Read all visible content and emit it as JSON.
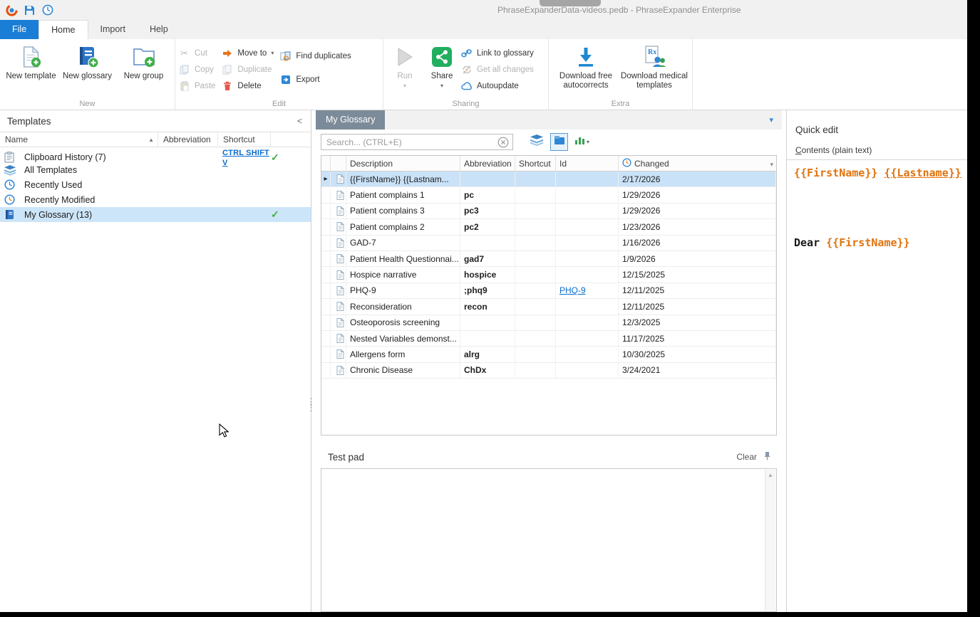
{
  "titlebar": {
    "title": "PhraseExpanderData-videos.pedb - PhraseExpander Enterprise"
  },
  "ribbon_tabs": {
    "file": "File",
    "home": "Home",
    "import": "Import",
    "help": "Help"
  },
  "ribbon": {
    "groups": {
      "new": {
        "label": "New",
        "new_template": "New template",
        "new_glossary": "New glossary",
        "new_group": "New group"
      },
      "edit": {
        "label": "Edit",
        "cut": "Cut",
        "copy": "Copy",
        "paste": "Paste",
        "move_to": "Move to",
        "duplicate": "Duplicate",
        "delete": "Delete",
        "find_duplicates": "Find duplicates",
        "export": "Export"
      },
      "sharing": {
        "label": "Sharing",
        "run": "Run",
        "share": "Share",
        "link_to_glossary": "Link to glossary",
        "get_all_changes": "Get all changes",
        "autoupdate": "Autoupdate"
      },
      "extra": {
        "label": "Extra",
        "download_autocorrects_line1": "Download free",
        "download_autocorrects_line2": "autocorrects",
        "download_medical_line1": "Download medical",
        "download_medical_line2": "templates"
      }
    }
  },
  "templates_panel": {
    "title": "Templates",
    "columns": {
      "name": "Name",
      "abbreviation": "Abbreviation",
      "shortcut": "Shortcut"
    },
    "items": [
      {
        "name": "Clipboard History (7)",
        "shortcut": "CTRL SHIFT V",
        "checked": true,
        "selected": false,
        "icon": "clipboard-icon"
      },
      {
        "name": "All Templates",
        "shortcut": "",
        "checked": false,
        "selected": false,
        "icon": "layers-icon"
      },
      {
        "name": "Recently Used",
        "shortcut": "",
        "checked": false,
        "selected": false,
        "icon": "clock-icon"
      },
      {
        "name": "Recently Modified",
        "shortcut": "",
        "checked": false,
        "selected": false,
        "icon": "clock-modified-icon"
      },
      {
        "name": "My Glossary (13)",
        "shortcut": "",
        "checked": true,
        "selected": true,
        "icon": "glossary-book-icon"
      }
    ]
  },
  "glossary_panel": {
    "tab_title": "My Glossary",
    "search_placeholder": "Search... (CTRL+E)",
    "columns": {
      "description": "Description",
      "abbreviation": "Abbreviation",
      "shortcut": "Shortcut",
      "id": "Id",
      "changed": "Changed"
    },
    "rows": [
      {
        "description": "{{FirstName}} {{Lastnam...",
        "abbreviation": "",
        "shortcut": "",
        "id": "",
        "changed": "2/17/2026",
        "selected": true
      },
      {
        "description": "Patient complains 1",
        "abbreviation": "pc",
        "shortcut": "",
        "id": "",
        "changed": "1/29/2026"
      },
      {
        "description": "Patient complains 3",
        "abbreviation": "pc3",
        "shortcut": "",
        "id": "",
        "changed": "1/29/2026"
      },
      {
        "description": "Patient complains 2",
        "abbreviation": "pc2",
        "shortcut": "",
        "id": "",
        "changed": "1/23/2026"
      },
      {
        "description": "GAD-7",
        "abbreviation": "",
        "shortcut": "",
        "id": "",
        "changed": "1/16/2026"
      },
      {
        "description": "Patient Health Questionnai...",
        "abbreviation": "gad7",
        "shortcut": "",
        "id": "",
        "changed": "1/9/2026"
      },
      {
        "description": "Hospice narrative",
        "abbreviation": "hospice",
        "shortcut": "",
        "id": "",
        "changed": "12/15/2025"
      },
      {
        "description": "PHQ-9",
        "abbreviation": ";phq9",
        "shortcut": "",
        "id": "PHQ-9",
        "id_link": true,
        "changed": "12/11/2025"
      },
      {
        "description": "Reconsideration",
        "abbreviation": "recon",
        "shortcut": "",
        "id": "",
        "changed": "12/11/2025"
      },
      {
        "description": "Osteoporosis screening",
        "abbreviation": "",
        "shortcut": "",
        "id": "",
        "changed": "12/3/2025"
      },
      {
        "description": "Nested Variables demonst...",
        "abbreviation": "",
        "shortcut": "",
        "id": "",
        "changed": "11/17/2025"
      },
      {
        "description": "Allergens form",
        "abbreviation": "alrg",
        "shortcut": "",
        "id": "",
        "changed": "10/30/2025"
      },
      {
        "description": "Chronic Disease",
        "abbreviation": "ChDx",
        "shortcut": "",
        "id": "",
        "changed": "3/24/2021"
      }
    ]
  },
  "test_pad": {
    "title": "Test pad",
    "clear_label": "Clear"
  },
  "quick_edit": {
    "title": "Quick edit",
    "contents_label_accel": "C",
    "contents_label_rest": "ontents (plain text)",
    "lines": [
      [
        {
          "t": "{{FirstName}}",
          "s": "var"
        },
        {
          "t": " ",
          "s": "plain"
        },
        {
          "t": "{{Lastname}}",
          "s": "varu"
        }
      ],
      [],
      [],
      [],
      [],
      [
        {
          "t": "Dear ",
          "s": "bold"
        },
        {
          "t": "{{FirstName}}",
          "s": "var"
        }
      ]
    ]
  },
  "glyphs": {
    "collapse_left": "<",
    "sort_asc": "▲",
    "dropdown": "▾",
    "check": "✓",
    "row_arrow": "▸",
    "splitter_dots": "⋮",
    "scroll_up": "▲",
    "scissors": "✂"
  },
  "colors": {
    "accent_blue": "#1a7ed6",
    "selection_blue": "#c9e2f7",
    "doc_tab_gray_blue": "#7c8b99",
    "variable_orange": "#e0730e",
    "check_green": "#3cb043",
    "link_blue": "#0a6cce",
    "disabled_gray": "#b3b3b3",
    "delete_red": "#e2574c",
    "share_green": "#21ae5f"
  }
}
